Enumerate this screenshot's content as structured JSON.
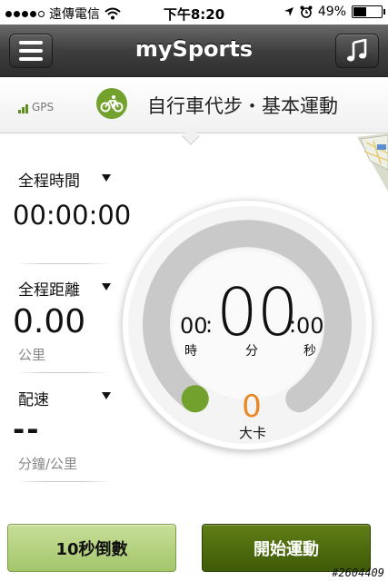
{
  "status_bar": {
    "carrier": "遠傳電信",
    "time": "下午8:20",
    "battery": "49%",
    "battery_level": 0.49,
    "icons": [
      "signal-dots-icon",
      "wifi-icon",
      "location-arrow-icon",
      "alarm-icon",
      "battery-icon"
    ]
  },
  "nav": {
    "title": "mySports",
    "menu_icon": "hamburger-menu-icon",
    "music_icon": "music-note-icon"
  },
  "activity": {
    "gps_label": "GPS",
    "title": "自行車代步・基本運動",
    "icon": "bicycle-icon",
    "accent_color": "#73a12d"
  },
  "stats": {
    "total_time": {
      "label": "全程時間",
      "value": "00:00:00"
    },
    "total_distance": {
      "label": "全程距離",
      "value": "0.00",
      "unit": "公里"
    },
    "pace": {
      "label": "配速",
      "value": "--",
      "unit": "分鐘/公里"
    }
  },
  "timer": {
    "hours": "00",
    "minutes": "00",
    "seconds": "00",
    "hours_unit": "時",
    "minutes_unit": "分",
    "seconds_unit": "秒",
    "progress": 0
  },
  "calories": {
    "value": "0",
    "label": "大卡",
    "color": "#e98824"
  },
  "buttons": {
    "countdown": "10秒倒數",
    "start": "開始運動"
  },
  "watermark": "#2604409"
}
